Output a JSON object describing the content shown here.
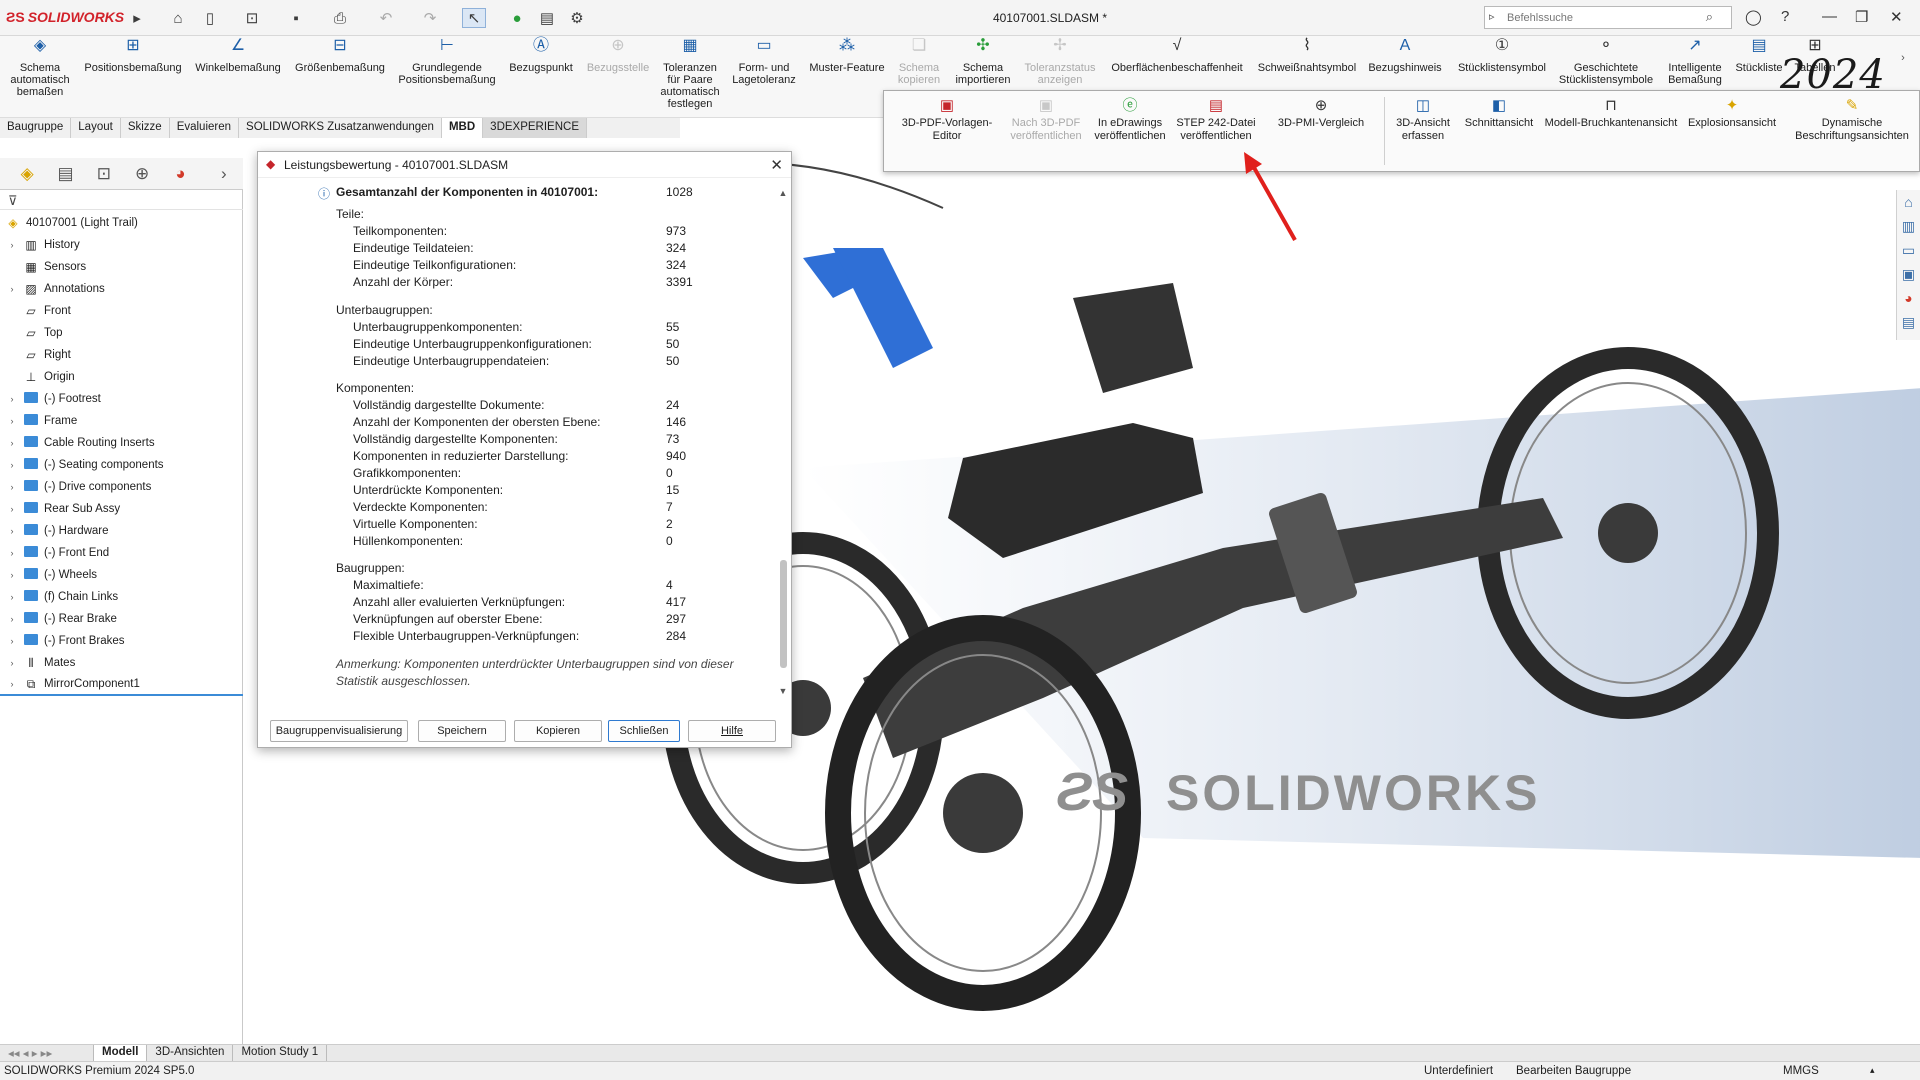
{
  "app": {
    "brand": "SOLIDWORKS",
    "doc_title": "40107001.SLDASM *",
    "watermark_year": "2024"
  },
  "search": {
    "placeholder": "Befehlssuche"
  },
  "ribbon": [
    "Schema automatisch bemaßen",
    "Positionsbemaßung",
    "Winkelbemaßung",
    "Größenbemaßung",
    "Grundlegende Positionsbemaßung",
    "Bezugspunkt",
    "Bezugsstelle",
    "Toleranzen für Paare automatisch festlegen",
    "Form- und Lagetoleranz",
    "Muster-Feature",
    "Schema kopieren",
    "Schema importieren",
    "Toleranzstatus anzeigen",
    "Oberflächenbeschaffenheit",
    "Schweißnahtsymbol",
    "Bezugshinweis",
    "Stücklistensymbol",
    "Geschichtete Stücklistensymbole",
    "Intelligente Bemaßung",
    "Stückliste",
    "Tabellen"
  ],
  "command_tabs": [
    "Baugruppe",
    "Layout",
    "Skizze",
    "Evaluieren",
    "SOLIDWORKS Zusatzanwendungen",
    "MBD",
    "3DEXPERIENCE"
  ],
  "popup": [
    "3D-PDF-Vorlagen-Editor",
    "Nach 3D-PDF veröffentlichen",
    "In eDrawings veröffentlichen",
    "STEP 242-Datei veröffentlichen",
    "3D-PMI-Vergleich",
    "3D-Ansicht erfassen",
    "Schnittansicht",
    "Modell-Bruchkantenansicht",
    "Explosionsansicht",
    "Dynamische Beschriftungsansichten"
  ],
  "tree": {
    "root": "40107001 (Light Trail)",
    "items": [
      "History",
      "Sensors",
      "Annotations",
      "Front",
      "Top",
      "Right",
      "Origin",
      "(-) Footrest",
      "Frame",
      "Cable Routing Inserts",
      "(-) Seating components",
      "(-) Drive components",
      "Rear Sub Assy",
      "(-) Hardware",
      "(-) Front End",
      "(-) Wheels",
      "(f) Chain Links",
      "(-) Rear Brake",
      "(-) Front Brakes",
      "Mates",
      "MirrorComponent1"
    ]
  },
  "dialog": {
    "title": "Leistungsbewertung - 40107001.SLDASM",
    "total_label": "Gesamtanzahl der Komponenten in 40107001:",
    "total_value": "1028",
    "sections": [
      {
        "head": "Teile:",
        "rows": [
          [
            "Teilkomponenten:",
            "973"
          ],
          [
            "Eindeutige Teildateien:",
            "324"
          ],
          [
            "Eindeutige Teilkonfigurationen:",
            "324"
          ],
          [
            "Anzahl der Körper:",
            "3391"
          ]
        ]
      },
      {
        "head": "Unterbaugruppen:",
        "rows": [
          [
            "Unterbaugruppenkomponenten:",
            "55"
          ],
          [
            "Eindeutige Unterbaugruppenkonfigurationen:",
            "50"
          ],
          [
            "Eindeutige Unterbaugruppendateien:",
            "50"
          ]
        ]
      },
      {
        "head": "Komponenten:",
        "rows": [
          [
            "Vollständig dargestellte Dokumente:",
            "24"
          ],
          [
            "Anzahl der Komponenten der obersten Ebene:",
            "146"
          ],
          [
            "Vollständig dargestellte Komponenten:",
            "73"
          ],
          [
            "Komponenten in reduzierter Darstellung:",
            "940"
          ],
          [
            "Grafikkomponenten:",
            "0"
          ],
          [
            "Unterdrückte Komponenten:",
            "15"
          ],
          [
            "Verdeckte Komponenten:",
            "7"
          ],
          [
            "Virtuelle Komponenten:",
            "2"
          ],
          [
            "Hüllenkomponenten:",
            "0"
          ]
        ]
      },
      {
        "head": "Baugruppen:",
        "rows": [
          [
            "Maximaltiefe:",
            "4"
          ],
          [
            "Anzahl aller evaluierten Verknüpfungen:",
            "417"
          ],
          [
            "Verknüpfungen auf oberster Ebene:",
            "297"
          ],
          [
            "Flexible Unterbaugruppen-Verknüpfungen:",
            "284"
          ]
        ]
      }
    ],
    "note": "Anmerkung: Komponenten unterdrückter Unterbaugruppen sind von dieser Statistik ausgeschlossen.",
    "buttons": [
      "Baugruppenvisualisierung",
      "Speichern",
      "Kopieren",
      "Schließen",
      "Hilfe"
    ]
  },
  "bottom_tabs": [
    "Modell",
    "3D-Ansichten",
    "Motion Study 1"
  ],
  "status": {
    "version": "SOLIDWORKS Premium 2024 SP5.0",
    "state": "Unterdefiniert",
    "mode": "Bearbeiten Baugruppe",
    "units": "MMGS"
  }
}
